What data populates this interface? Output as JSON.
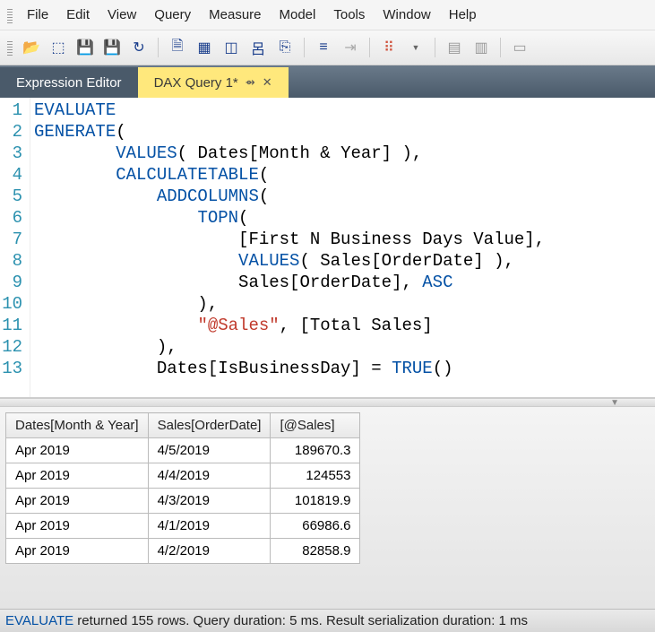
{
  "menu": [
    "File",
    "Edit",
    "View",
    "Query",
    "Measure",
    "Model",
    "Tools",
    "Window",
    "Help"
  ],
  "tabs": {
    "inactive": "Expression Editor",
    "active": "DAX Query 1*"
  },
  "code": {
    "lines": [
      [
        {
          "t": "EVALUATE",
          "c": "kw"
        }
      ],
      [
        {
          "t": "GENERATE",
          "c": "kw"
        },
        {
          "t": "(",
          "c": "id"
        }
      ],
      [
        {
          "t": "        ",
          "c": "id"
        },
        {
          "t": "VALUES",
          "c": "fn"
        },
        {
          "t": "( Dates[Month & Year] ),",
          "c": "id"
        }
      ],
      [
        {
          "t": "        ",
          "c": "id"
        },
        {
          "t": "CALCULATETABLE",
          "c": "fn"
        },
        {
          "t": "(",
          "c": "id"
        }
      ],
      [
        {
          "t": "            ",
          "c": "id"
        },
        {
          "t": "ADDCOLUMNS",
          "c": "fn"
        },
        {
          "t": "(",
          "c": "id"
        }
      ],
      [
        {
          "t": "                ",
          "c": "id"
        },
        {
          "t": "TOPN",
          "c": "fn"
        },
        {
          "t": "(",
          "c": "id"
        }
      ],
      [
        {
          "t": "                    [First N Business Days Value],",
          "c": "id"
        }
      ],
      [
        {
          "t": "                    ",
          "c": "id"
        },
        {
          "t": "VALUES",
          "c": "fn"
        },
        {
          "t": "( Sales[OrderDate] ),",
          "c": "id"
        }
      ],
      [
        {
          "t": "                    Sales[OrderDate], ",
          "c": "id"
        },
        {
          "t": "ASC",
          "c": "kw"
        }
      ],
      [
        {
          "t": "                ),",
          "c": "id"
        }
      ],
      [
        {
          "t": "                ",
          "c": "id"
        },
        {
          "t": "\"@Sales\"",
          "c": "str"
        },
        {
          "t": ", [Total Sales]",
          "c": "id"
        }
      ],
      [
        {
          "t": "            ),",
          "c": "id"
        }
      ],
      [
        {
          "t": "            Dates[IsBusinessDay] = ",
          "c": "id"
        },
        {
          "t": "TRUE",
          "c": "fn"
        },
        {
          "t": "()",
          "c": "id"
        }
      ]
    ]
  },
  "grid": {
    "headers": [
      "Dates[Month & Year]",
      "Sales[OrderDate]",
      "[@Sales]"
    ],
    "rows": [
      [
        "Apr 2019",
        "4/5/2019",
        "189670.3"
      ],
      [
        "Apr 2019",
        "4/4/2019",
        "124553"
      ],
      [
        "Apr 2019",
        "4/3/2019",
        "101819.9"
      ],
      [
        "Apr 2019",
        "4/1/2019",
        "66986.6"
      ],
      [
        "Apr 2019",
        "4/2/2019",
        "82858.9"
      ]
    ]
  },
  "status": {
    "prefix": "EVALUATE",
    "rest": " returned 155 rows. Query duration: 5 ms. Result serialization duration: 1 ms"
  },
  "toolbar_icons": [
    "folder-open-icon",
    "cube-icon",
    "save-icon",
    "save-all-icon",
    "undo-icon",
    "document-icon",
    "properties-icon",
    "query-icon",
    "graph-icon",
    "execute-icon",
    "indent-icon",
    "outdent-icon",
    "filter-icon",
    "align-icon",
    "columns-icon"
  ]
}
